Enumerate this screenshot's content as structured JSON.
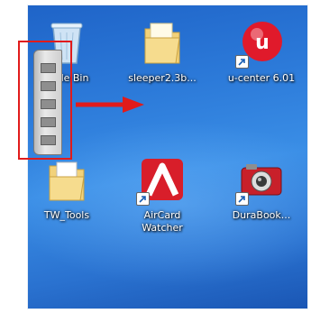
{
  "desktop": {
    "icons": [
      {
        "label": "Recycle Bin",
        "visible_label": "cle Bin",
        "icon": "recycle-bin-icon"
      },
      {
        "label": "sleeper2.3b...",
        "icon": "folder-icon"
      },
      {
        "label": "u-center 6.01",
        "icon": "u-center-icon"
      },
      {
        "label": "TW_Tools",
        "icon": "folder-doc-icon"
      },
      {
        "label": "AirCard Watcher",
        "line1": "AirCard",
        "line2": "Watcher",
        "icon": "aircard-icon"
      },
      {
        "label": "DuraBook...",
        "icon": "durabook-camera-icon"
      }
    ]
  },
  "annotation": {
    "highlight_color": "#e11b1b",
    "arrow_color": "#e11b1b",
    "handle_icon": "drag-handle-icon"
  }
}
